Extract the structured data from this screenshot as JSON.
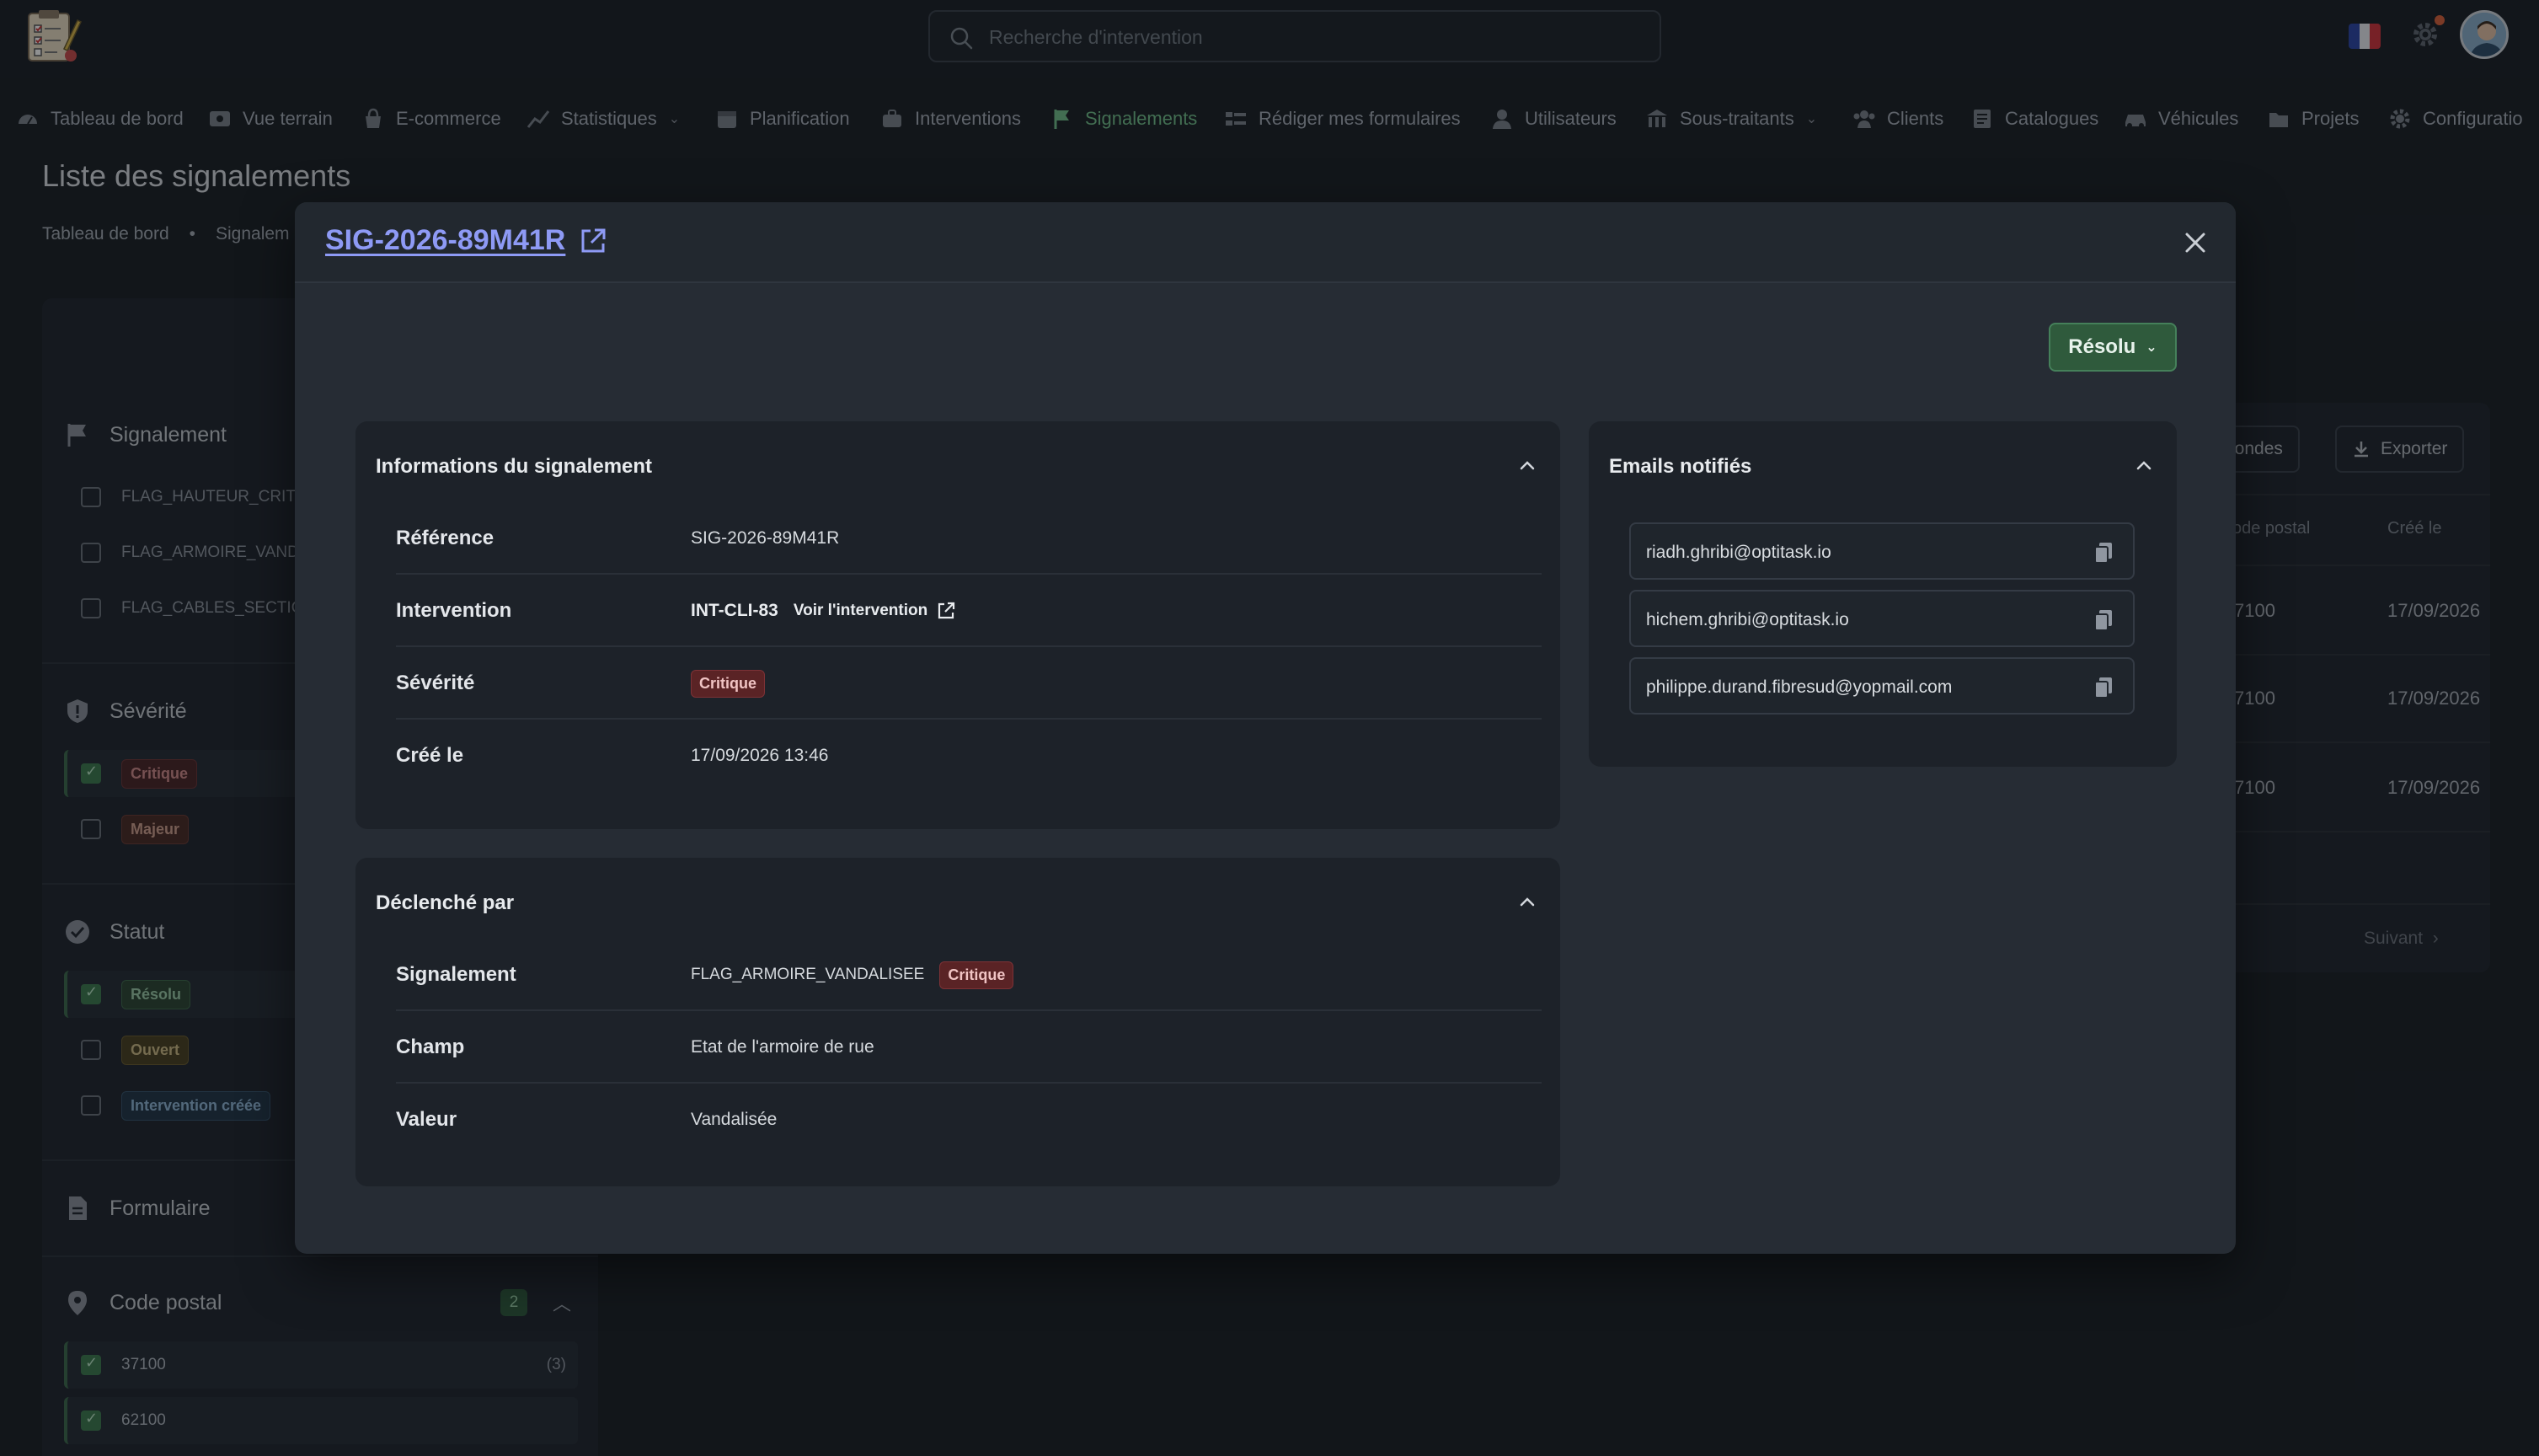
{
  "header": {
    "search_placeholder": "Recherche d'intervention",
    "language": "fr"
  },
  "nav": {
    "items": [
      {
        "label": "Tableau de bord",
        "icon": "gauge-icon"
      },
      {
        "label": "Vue terrain",
        "icon": "map-view-icon"
      },
      {
        "label": "E-commerce",
        "icon": "shopping-bag-icon"
      },
      {
        "label": "Statistiques",
        "icon": "chart-icon",
        "has_dropdown": true
      },
      {
        "label": "Planification",
        "icon": "calendar-icon"
      },
      {
        "label": "Interventions",
        "icon": "toolbox-icon"
      },
      {
        "label": "Signalements",
        "icon": "flag-icon",
        "active": true
      },
      {
        "label": "Rédiger mes formulaires",
        "icon": "form-icon"
      },
      {
        "label": "Utilisateurs",
        "icon": "user-icon"
      },
      {
        "label": "Sous-traitants",
        "icon": "building-icon",
        "has_dropdown": true
      },
      {
        "label": "Clients",
        "icon": "users-icon"
      },
      {
        "label": "Catalogues",
        "icon": "catalog-icon"
      },
      {
        "label": "Véhicules",
        "icon": "car-icon"
      },
      {
        "label": "Projets",
        "icon": "folder-icon"
      },
      {
        "label": "Configuratio",
        "icon": "gear-icon"
      }
    ]
  },
  "page": {
    "title": "Liste des signalements",
    "breadcrumb": [
      "Tableau de bord",
      "•",
      "Signalem"
    ]
  },
  "sidebar": {
    "signalement_title": "Signalement",
    "signalement_items": [
      "FLAG_HAUTEUR_CRITIQ",
      "FLAG_ARMOIRE_VANDA",
      "FLAG_CABLES_SECTION"
    ],
    "severite_title": "Sévérité",
    "severite_items": [
      {
        "label": "Critique",
        "checked": true
      },
      {
        "label": "Majeur",
        "checked": false
      }
    ],
    "statut_title": "Statut",
    "statut_items": [
      {
        "label": "Résolu",
        "checked": true
      },
      {
        "label": "Ouvert",
        "checked": false
      },
      {
        "label": "Intervention créée",
        "checked": false
      }
    ],
    "formulaire_title": "Formulaire",
    "code_postal_title": "Code postal",
    "code_postal_count": "2",
    "code_postal_items": [
      {
        "label": "37100",
        "count": "(3)",
        "checked": true
      },
      {
        "label": "62100",
        "count": "",
        "checked": true
      }
    ]
  },
  "background_table": {
    "btn_seconds": "secondes",
    "btn_export": "Exporter",
    "col_postal": "ode postal",
    "col_created": "Créé le",
    "rows": [
      {
        "postal": "7100",
        "created": "17/09/2026"
      },
      {
        "postal": "7100",
        "created": "17/09/2026"
      },
      {
        "postal": "7100",
        "created": "17/09/2026"
      }
    ],
    "next": "Suivant"
  },
  "modal": {
    "title": "SIG-2026-89M41R",
    "status": "Résolu",
    "info_card": {
      "title": "Informations du signalement",
      "reference_label": "Référence",
      "reference_value": "SIG-2026-89M41R",
      "intervention_label": "Intervention",
      "intervention_value": "INT-CLI-83",
      "intervention_link": "Voir l'intervention",
      "severity_label": "Sévérité",
      "severity_value": "Critique",
      "created_label": "Créé le",
      "created_value": "17/09/2026 13:46"
    },
    "trigger_card": {
      "title": "Déclenché par",
      "signalement_label": "Signalement",
      "signalement_value": "FLAG_ARMOIRE_VANDALISEE",
      "signalement_badge": "Critique",
      "field_label": "Champ",
      "field_value": "Etat de l'armoire de rue",
      "value_label": "Valeur",
      "value_value": "Vandalisée"
    },
    "emails_card": {
      "title": "Emails notifiés",
      "emails": [
        "riadh.ghribi@optitask.io",
        "hichem.ghribi@optitask.io",
        "philippe.durand.fibresud@yopmail.com"
      ]
    }
  },
  "colors": {
    "accent_green": "#2f5a3c",
    "link_purple": "#8e9af5",
    "critical_red": "#5a2325",
    "nav_active": "#72c08a"
  }
}
